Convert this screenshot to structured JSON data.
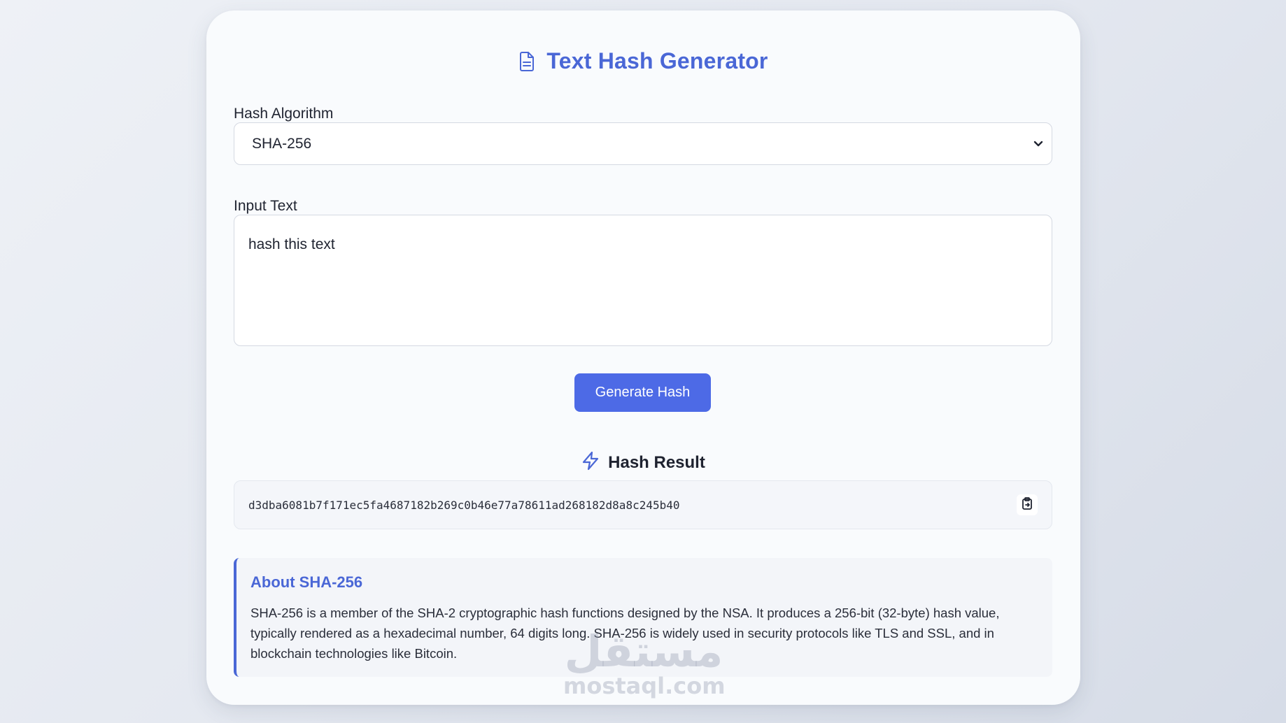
{
  "header": {
    "title": "Text Hash Generator",
    "icon": "document-icon"
  },
  "algorithm": {
    "label": "Hash Algorithm",
    "selected": "SHA-256"
  },
  "input": {
    "label": "Input Text",
    "value": "hash this text"
  },
  "actions": {
    "generate_label": "Generate Hash"
  },
  "result": {
    "title": "Hash Result",
    "icon": "lightning-icon",
    "hash": "d3dba6081b7f171ec5fa4687182b269c0b46e77a78611ad268182d8a8c245b40",
    "copy_icon": "clipboard-icon"
  },
  "about": {
    "title": "About SHA-256",
    "text": "SHA-256 is a member of the SHA-2 cryptographic hash functions designed by the NSA. It produces a 256-bit (32-byte) hash value, typically rendered as a hexadecimal number, 64 digits long. SHA-256 is widely used in security protocols like TLS and SSL, and in blockchain technologies like Bitcoin."
  },
  "watermark": {
    "arabic": "مستقل",
    "latin": "mostaql.com"
  },
  "colors": {
    "accent": "#4a67d6",
    "button": "#4d6ae6",
    "card": "#f9fbfd"
  }
}
